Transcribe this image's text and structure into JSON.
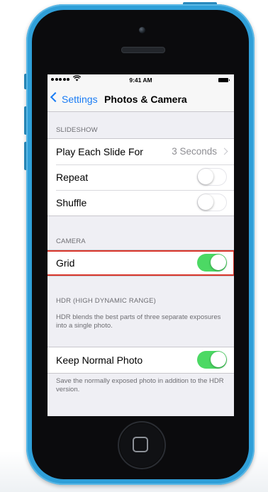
{
  "status_bar": {
    "time": "9:41 AM",
    "wifi_icon": "wifi-icon"
  },
  "nav": {
    "back_label": "Settings",
    "title": "Photos & Camera"
  },
  "slideshow": {
    "header": "SLIDESHOW",
    "items": [
      {
        "label": "Play Each Slide For",
        "value": "3 Seconds",
        "type": "disclosure"
      },
      {
        "label": "Repeat",
        "type": "toggle",
        "on": false
      },
      {
        "label": "Shuffle",
        "type": "toggle",
        "on": false
      }
    ]
  },
  "camera": {
    "header": "CAMERA",
    "items": [
      {
        "label": "Grid",
        "type": "toggle",
        "on": true,
        "highlighted": true
      }
    ]
  },
  "hdr": {
    "header": "HDR (HIGH DYNAMIC RANGE)",
    "description": "HDR blends the best parts of three separate exposures into a single photo.",
    "items": [
      {
        "label": "Keep Normal Photo",
        "type": "toggle",
        "on": true
      }
    ],
    "footer": "Save the normally exposed photo in addition to the HDR version."
  },
  "colors": {
    "accent": "#1a7cf4",
    "toggle_on": "#4cd964",
    "highlight": "#d9362b",
    "phone_case": "#2f9fd8"
  }
}
